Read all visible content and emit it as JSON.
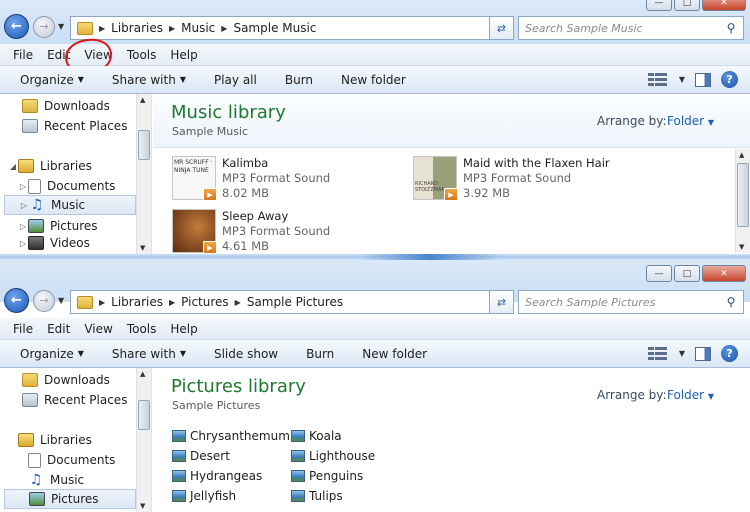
{
  "windows": [
    {
      "address": [
        "Libraries",
        "Music",
        "Sample Music"
      ],
      "search_placeholder": "Search Sample Music",
      "menu": [
        "File",
        "Edit",
        "View",
        "Tools",
        "Help"
      ],
      "commands": [
        {
          "label": "Organize",
          "dropdown": true
        },
        {
          "label": "Share with",
          "dropdown": true
        },
        {
          "label": "Play all",
          "dropdown": false
        },
        {
          "label": "Burn",
          "dropdown": false
        },
        {
          "label": "New folder",
          "dropdown": false
        }
      ],
      "nav": [
        {
          "label": "Downloads",
          "icon": "downloads-folder-icon"
        },
        {
          "label": "Recent Places",
          "icon": "recent-places-icon"
        },
        {
          "label": "Libraries",
          "icon": "libraries-icon"
        },
        {
          "label": "Documents",
          "icon": "documents-icon"
        },
        {
          "label": "Music",
          "icon": "music-icon"
        },
        {
          "label": "Pictures",
          "icon": "pictures-icon"
        },
        {
          "label": "Videos",
          "icon": "videos-icon"
        }
      ],
      "library_title": "Music library",
      "library_subtitle": "Sample Music",
      "arrange_label": "Arrange by:",
      "arrange_value": "Folder",
      "tracks": [
        {
          "name": "Kalimba",
          "type": "MP3 Format Sound",
          "size": "8.02 MB",
          "art": "MR SCRUFF · NINJA TUNE"
        },
        {
          "name": "Maid with the Flaxen Hair",
          "type": "MP3 Format Sound",
          "size": "3.92 MB",
          "art": "RICHARD STOLTZMAN"
        },
        {
          "name": "Sleep Away",
          "type": "MP3 Format Sound",
          "size": "4.61 MB",
          "art": ""
        }
      ]
    },
    {
      "address": [
        "Libraries",
        "Pictures",
        "Sample Pictures"
      ],
      "search_placeholder": "Search Sample Pictures",
      "menu": [
        "File",
        "Edit",
        "View",
        "Tools",
        "Help"
      ],
      "commands": [
        {
          "label": "Organize",
          "dropdown": true
        },
        {
          "label": "Share with",
          "dropdown": true
        },
        {
          "label": "Slide show",
          "dropdown": false
        },
        {
          "label": "Burn",
          "dropdown": false
        },
        {
          "label": "New folder",
          "dropdown": false
        }
      ],
      "nav": [
        {
          "label": "Downloads",
          "icon": "downloads-folder-icon"
        },
        {
          "label": "Recent Places",
          "icon": "recent-places-icon"
        },
        {
          "label": "Libraries",
          "icon": "libraries-icon"
        },
        {
          "label": "Documents",
          "icon": "documents-icon"
        },
        {
          "label": "Music",
          "icon": "music-icon"
        },
        {
          "label": "Pictures",
          "icon": "pictures-icon"
        }
      ],
      "library_title": "Pictures library",
      "library_subtitle": "Sample Pictures",
      "arrange_label": "Arrange by:",
      "arrange_value": "Folder",
      "pictures": [
        "Chrysanthemum",
        "Desert",
        "Hydrangeas",
        "Jellyfish",
        "Koala",
        "Lighthouse",
        "Penguins",
        "Tulips"
      ]
    }
  ],
  "accent_colors": {
    "title_green": "#1e7a2e",
    "link_blue": "#1e5fb4",
    "annotation_red": "#e01616"
  }
}
